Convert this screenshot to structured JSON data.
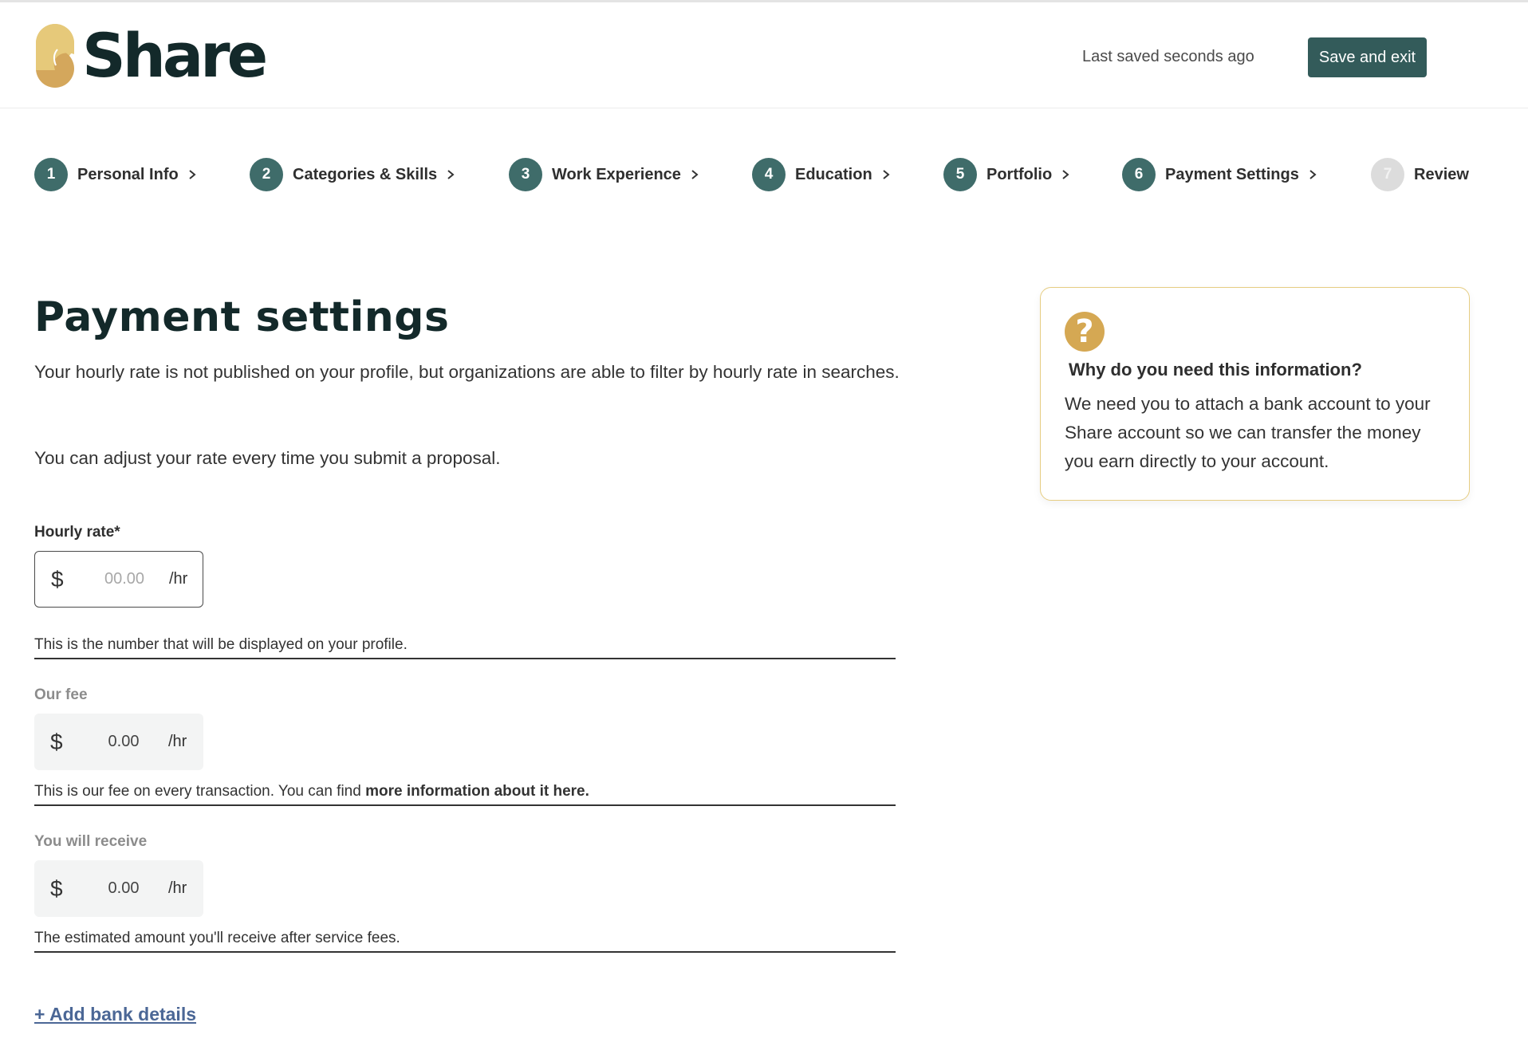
{
  "header": {
    "logo_text": "Share",
    "last_saved": "Last saved seconds ago",
    "save_exit_label": "Save and exit"
  },
  "stepper": {
    "steps": [
      {
        "number": "1",
        "label": "Personal Info",
        "state": "complete"
      },
      {
        "number": "2",
        "label": "Categories & Skills",
        "state": "complete"
      },
      {
        "number": "3",
        "label": "Work Experience",
        "state": "complete"
      },
      {
        "number": "4",
        "label": "Education",
        "state": "complete"
      },
      {
        "number": "5",
        "label": "Portfolio",
        "state": "complete"
      },
      {
        "number": "6",
        "label": "Payment Settings",
        "state": "current"
      },
      {
        "number": "7",
        "label": "Review",
        "state": "upcoming"
      }
    ]
  },
  "main": {
    "title": "Payment settings",
    "description_1": "Your hourly rate is not published on your profile, but organizations are able to filter by hourly rate in searches.",
    "description_2": "You can adjust your rate every time you submit a proposal.",
    "hourly_rate": {
      "label": "Hourly rate*",
      "currency": "$",
      "value": "",
      "placeholder": "00.00",
      "unit": "/hr",
      "helper": "This is the number that will be displayed on your profile."
    },
    "our_fee": {
      "label": "Our fee",
      "currency": "$",
      "value": "0.00",
      "unit": "/hr",
      "helper_prefix": "This is our fee on every transaction. You can find ",
      "helper_link": "more information about it here."
    },
    "you_will_receive": {
      "label": "You will receive",
      "currency": "$",
      "value": "0.00",
      "unit": "/hr",
      "helper": "The estimated amount you'll receive after service fees."
    },
    "add_bank_label": "+ Add bank details"
  },
  "info_box": {
    "icon": "question-mark-icon",
    "icon_glyph": "?",
    "title": "Why do you need this information?",
    "body": "We need you to attach a bank account to your Share account so we can transfer the money you earn directly to your account."
  },
  "colors": {
    "brand_dark": "#13292a",
    "accent_teal": "#335b5a",
    "step_complete": "#3f6c6a",
    "step_upcoming": "#dcdcdc",
    "gold": "#d5a853",
    "link_blue": "#4b6796"
  }
}
